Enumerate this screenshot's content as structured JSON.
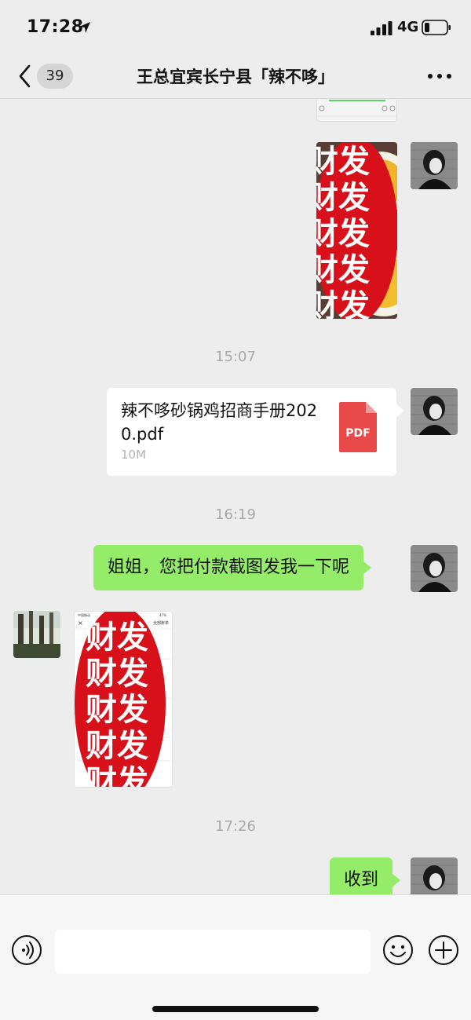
{
  "status_bar": {
    "time": "17:28",
    "network": "4G",
    "icons": [
      "location-arrow-icon",
      "signal-bars-icon",
      "battery-icon"
    ]
  },
  "nav": {
    "back_icon": "chevron-left-icon",
    "unread_count": "39",
    "title": "王总宜宾长宁县「辣不哆」",
    "more_icon": "more-dots-icon"
  },
  "messages": {
    "watermark_text": "财发",
    "timestamp_1": "15:07",
    "file": {
      "name": "辣不哆砂锅鸡招商手册2020.pdf",
      "size": "10M",
      "type_label": "PDF"
    },
    "timestamp_2": "16:19",
    "text_1": "姐姐，您把付款截图发我一下呢",
    "received_screenshot": {
      "carrier": "中国移动",
      "battery": "47%",
      "header_title": "全部账单"
    },
    "timestamp_3": "17:26",
    "text_2": "收到"
  },
  "input_bar": {
    "placeholder": "",
    "icons": [
      "voice-icon",
      "emoji-icon",
      "plus-icon"
    ]
  },
  "colors": {
    "background": "#ededed",
    "sent_bubble": "#95ec69",
    "pdf_red": "#e84a4a",
    "watermark_red": "#d8101a"
  }
}
